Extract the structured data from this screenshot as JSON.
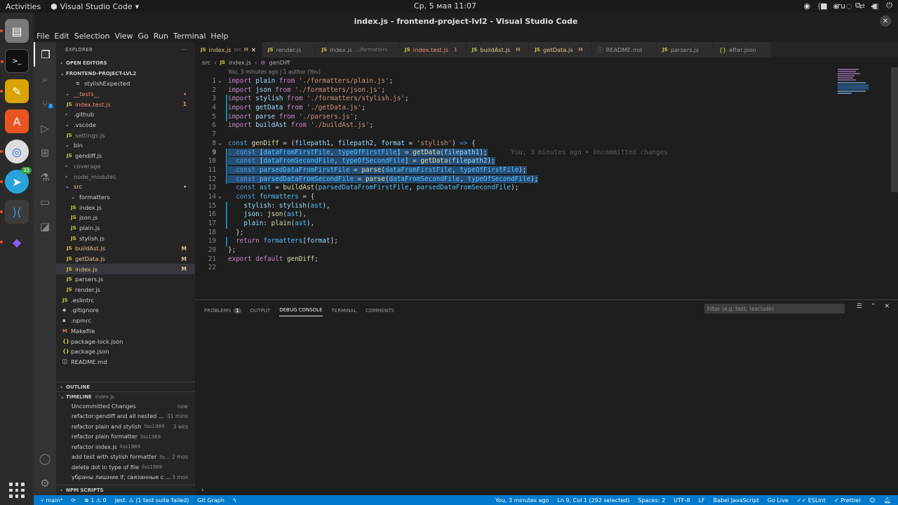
{
  "os": {
    "activities": "Activities",
    "app_name": "Visual Studio Code",
    "clock": "Ср, 5 мая  11:07",
    "lang": "ru"
  },
  "dock": {
    "telegram_badge": "33"
  },
  "window": {
    "title": "index.js - frontend-project-lvl2 - Visual Studio Code",
    "close": "✕"
  },
  "menu": [
    "File",
    "Edit",
    "Selection",
    "View",
    "Go",
    "Run",
    "Terminal",
    "Help"
  ],
  "activity": {
    "scm_badge": "3"
  },
  "explorer": {
    "header": "EXPLORER",
    "open_editors": "OPEN EDITORS",
    "project": "FRONTEND-PROJECT-LVL2",
    "items": [
      {
        "icon": "≡",
        "label": "stylishExpected",
        "indent": 28,
        "cls": "",
        "tag": ""
      },
      {
        "icon": "⌄",
        "label": "__tests__",
        "indent": 13,
        "cls": "err",
        "tag": "•"
      },
      {
        "icon": "JS",
        "label": "index.test.js",
        "indent": 15,
        "cls": "err",
        "tag": "1"
      },
      {
        "icon": "›",
        "label": ".github",
        "indent": 13,
        "cls": "",
        "tag": ""
      },
      {
        "icon": "⌄",
        "label": ".vscode",
        "indent": 13,
        "cls": "",
        "tag": ""
      },
      {
        "icon": "JS",
        "label": "settings.js",
        "indent": 15,
        "cls": "git",
        "tag": ""
      },
      {
        "icon": "⌄",
        "label": "bin",
        "indent": 13,
        "cls": "",
        "tag": ""
      },
      {
        "icon": "JS",
        "label": "gendiff.js",
        "indent": 15,
        "cls": "",
        "tag": ""
      },
      {
        "icon": "›",
        "label": "coverage",
        "indent": 13,
        "cls": "git",
        "tag": ""
      },
      {
        "icon": "›",
        "label": "node_modules",
        "indent": 13,
        "cls": "git",
        "tag": ""
      },
      {
        "icon": "⌄",
        "label": "src",
        "indent": 13,
        "cls": "mod",
        "tag": "•"
      },
      {
        "icon": "⌄",
        "label": "formatters",
        "indent": 21,
        "cls": "",
        "tag": ""
      },
      {
        "icon": "JS",
        "label": "index.js",
        "indent": 21,
        "cls": "",
        "tag": ""
      },
      {
        "icon": "JS",
        "label": "json.js",
        "indent": 21,
        "cls": "",
        "tag": ""
      },
      {
        "icon": "JS",
        "label": "plain.js",
        "indent": 21,
        "cls": "",
        "tag": ""
      },
      {
        "icon": "JS",
        "label": "stylish.js",
        "indent": 21,
        "cls": "",
        "tag": ""
      },
      {
        "icon": "JS",
        "label": "buildAst.js",
        "indent": 15,
        "cls": "mod",
        "tag": "M"
      },
      {
        "icon": "JS",
        "label": "getData.js",
        "indent": 15,
        "cls": "mod",
        "tag": "M"
      },
      {
        "icon": "JS",
        "label": "index.js",
        "indent": 15,
        "cls": "mod sel",
        "tag": "M"
      },
      {
        "icon": "JS",
        "label": "parsers.js",
        "indent": 15,
        "cls": "",
        "tag": ""
      },
      {
        "icon": "JS",
        "label": "render.js",
        "indent": 15,
        "cls": "",
        "tag": ""
      },
      {
        "icon": "JS",
        "label": ".eslintrc",
        "indent": 9,
        "cls": "",
        "tag": ""
      },
      {
        "icon": "◆",
        "label": ".gitignore",
        "indent": 9,
        "cls": "",
        "tag": ""
      },
      {
        "icon": "▪",
        "label": ".npmrc",
        "indent": 9,
        "cls": "",
        "tag": ""
      },
      {
        "icon": "M",
        "label": "Makefile",
        "indent": 9,
        "cls": "",
        "tag": ""
      },
      {
        "icon": "{}",
        "label": "package-lock.json",
        "indent": 9,
        "cls": "",
        "tag": ""
      },
      {
        "icon": "{}",
        "label": "package.json",
        "indent": 9,
        "cls": "",
        "tag": ""
      },
      {
        "icon": "ⓘ",
        "label": "README.md",
        "indent": 9,
        "cls": "",
        "tag": ""
      }
    ],
    "outline": "OUTLINE",
    "timeline": "TIMELINE",
    "timeline_file": "index.js",
    "npm": "NPM SCRIPTS"
  },
  "timeline": [
    {
      "msg": "Uncommitted Changes",
      "author": "",
      "time": "now"
    },
    {
      "msg": "refactor:gendiff and all nested ...",
      "author": "",
      "time": "31 mins"
    },
    {
      "msg": "refactor plain and stylish",
      "author": "llss1989",
      "time": "3 wks"
    },
    {
      "msg": "refactor plain formatter",
      "author": "llss1989",
      "time": ""
    },
    {
      "msg": "refactor index.js",
      "author": "llss1989",
      "time": ""
    },
    {
      "msg": "add test with stylish formatter",
      "author": "lls...",
      "time": "2 mos"
    },
    {
      "msg": "delete dot in type of file",
      "author": "llss1989",
      "time": ""
    },
    {
      "msg": "убраны лишние if, связанные с ...",
      "author": "",
      "time": "3 mos"
    }
  ],
  "tabs": [
    {
      "name": "index.js",
      "sub": "src",
      "flag": "M",
      "close": "✕",
      "on": true
    },
    {
      "name": "render.js",
      "sub": "",
      "flag": "",
      "close": "",
      "on": false
    },
    {
      "name": "index.js",
      "sub": ".../formatters",
      "flag": "",
      "close": "",
      "on": false
    },
    {
      "name": "index.test.js",
      "sub": "",
      "flag": "1",
      "close": "",
      "on": false
    },
    {
      "name": "buildAst.js",
      "sub": "",
      "flag": "M",
      "close": "",
      "on": false
    },
    {
      "name": "getData.js",
      "sub": "",
      "flag": "M",
      "close": "",
      "on": false
    },
    {
      "name": "README.md",
      "sub": "",
      "flag": "",
      "close": "",
      "on": false
    },
    {
      "name": "parsers.js",
      "sub": "",
      "flag": "",
      "close": "",
      "on": false
    },
    {
      "name": "after.json",
      "sub": "",
      "flag": "",
      "close": "",
      "on": false
    }
  ],
  "breadcrumb": {
    "folder": "src",
    "file": "index.js",
    "symbol": "genDiff"
  },
  "blame": "You, 3 minutes ago | 1 author (You)",
  "inline_blame": "You, 3 minutes ago • Uncommitted changes",
  "code": [
    "<span class='kw'>import</span> <span class='v'>plain</span> <span class='kw'>from</span> <span class='s'>'./formatters/plain.js'</span>;",
    "<span class='kw'>import</span> <span class='v'>json</span> <span class='kw'>from</span> <span class='s'>'./formatters/json.js'</span>;",
    "<span class='kw'>import</span> <span class='v'>stylish</span> <span class='kw'>from</span> <span class='s'>'./formatters/stylish.js'</span>;",
    "<span class='kw'>import</span> <span class='v'>getData</span> <span class='kw'>from</span> <span class='s'>'./getData.js'</span>;",
    "<span class='kw'>import</span> <span class='v'>parse</span> <span class='kw'>from</span> <span class='s'>'./parsers.js'</span>;",
    "<span class='kw'>import</span> <span class='v'>buildAst</span> <span class='kw'>from</span> <span class='s'>'./buildAst.js'</span>;",
    "",
    "<span class='k'>const</span> <span class='f'>genDiff</span> = (<span class='v'>filepath1</span>, <span class='v'>filepath2</span>, <span class='v'>format</span> = <span class='s'>'stylish'</span>) <span class='k'>=&gt;</span> {",
    "<span class='hl'>  <span class='k'>const</span> [<span class='c'>dataFromFirstFile</span>, <span class='c'>typeOfFirstFile</span>] = <span class='f'>getData</span>(<span class='v'>filepath1</span>);</span>",
    "<span class='hl'>  <span class='k'>const</span> [<span class='c'>dataFromSecondFile</span>, <span class='c'>typeOfSecondFile</span>] = <span class='f'>getData</span>(<span class='v'>filepath2</span>);</span>",
    "<span class='hl'>  <span class='k'>const</span> <span class='c'>parsedDataFromFirstFile</span> = <span class='f'>parse</span>(<span class='c'>dataFromFirstFile</span>, <span class='c'>typeOfFirstFile</span>);</span>",
    "<span class='hl'>  <span class='k'>const</span> <span class='c'>parsedDataFromSecondFile</span> = <span class='f'>parse</span>(<span class='c'>dataFromSecondFile</span>, <span class='c'>typeOfSecondFile</span>);</span>",
    "  <span class='k'>const</span> <span class='c'>ast</span> = <span class='f'>buildAst</span>(<span class='c'>parsedDataFromFirstFile</span>, <span class='c'>parsedDataFromSecondFile</span>);",
    "  <span class='k'>const</span> <span class='c'>formatters</span> = {",
    "    <span class='v'>stylish</span>: <span class='v'>stylish</span>(<span class='c'>ast</span>),",
    "    <span class='v'>json</span>: <span class='f'>json</span>(<span class='c'>ast</span>),",
    "    <span class='v'>plain</span>: <span class='f'>plain</span>(<span class='c'>ast</span>),",
    "  };",
    "  <span class='kw'>return</span> <span class='c'>formatters</span>[<span class='v'>format</span>];",
    "};",
    "<span class='kw'>export</span> <span class='kw'>default</span> <span class='f'>genDiff</span>;",
    ""
  ],
  "panel": {
    "tabs": [
      "PROBLEMS",
      "OUTPUT",
      "DEBUG CONSOLE",
      "TERMINAL",
      "COMMENTS"
    ],
    "problems_count": "1",
    "filter_placeholder": "Filter (e.g. text, !exclude)",
    "prompt": "›"
  },
  "status": {
    "branch": "main*",
    "sync": "⟳",
    "errors": "⊗ 1 ⚠ 0",
    "jest": "Jest: ⚠ (1 test suite failed)",
    "gitgraph": "Git Graph",
    "blame": "You, 3 minutes ago",
    "position": "Ln 9, Col 1 (292 selected)",
    "spaces": "Spaces: 2",
    "encoding": "UTF-8",
    "eol": "LF",
    "language": "Babel JavaScript",
    "golive": "Go Live",
    "eslint": "✓✓ ESLint",
    "prettier": "✓ Prettier"
  },
  "colors": {
    "accent": "#007acc",
    "selection": "#264f78"
  }
}
